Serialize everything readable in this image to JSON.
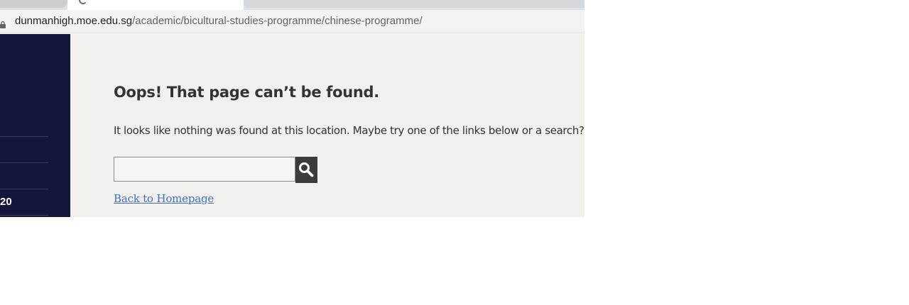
{
  "browser": {
    "url_host": "dunmanhigh.moe.edu.sg",
    "url_path": "/academic/bicultural-studies-programme/chinese-programme/"
  },
  "sidebar": {
    "partial_label": "20"
  },
  "error": {
    "title": "Oops! That page can’t be found.",
    "message": "It looks like nothing was found at this location. Maybe try one of the links below or a search?",
    "search_value": "",
    "search_icon": "magnifier-icon",
    "back_link": "Back to Homepage"
  },
  "colors": {
    "sidebar_bg": "#14163b",
    "content_bg": "#f0f0ec",
    "search_button_bg": "#3c3c3c",
    "link": "#3f6fc2"
  }
}
